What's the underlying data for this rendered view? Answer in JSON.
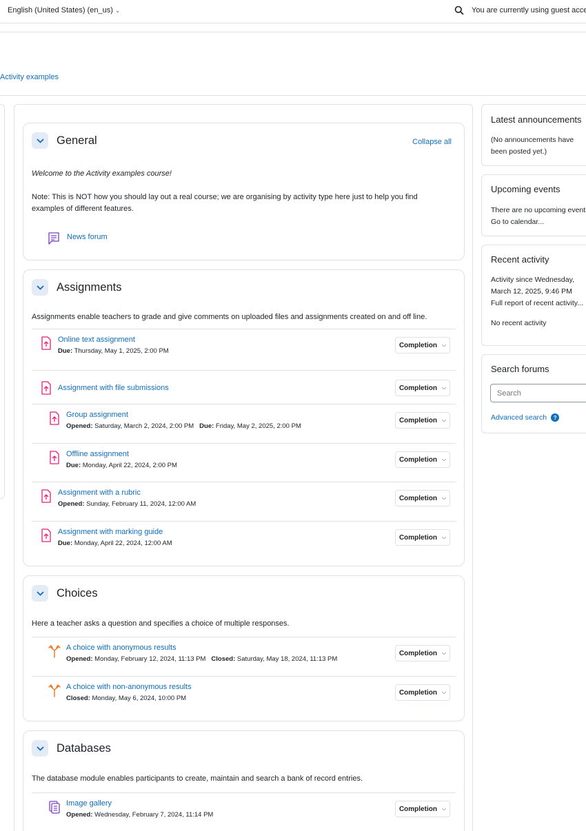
{
  "topbar": {
    "language": "English (United States) (en_us)",
    "guest_notice": "You are currently using guest access"
  },
  "breadcrumb": {
    "course": "Activity examples"
  },
  "sections": {
    "general": {
      "title": "General",
      "collapse_all": "Collapse all",
      "welcome": "Welcome to the Activity examples course!",
      "note": "Note: This is NOT how you should lay out a real course; we are organising by activity type here just to help you find examples of different features.",
      "activities": [
        {
          "name": "News forum",
          "icon": "forum-icon"
        }
      ]
    },
    "assignments": {
      "title": "Assignments",
      "summary": "Assignments enable teachers to grade and give comments on uploaded files and assignments created on and off line.",
      "activities": [
        {
          "name": "Online text assignment",
          "icon": "assignment-icon",
          "dates": [
            {
              "label": "Due:",
              "value": "Thursday, May 1, 2025, 2:00 PM"
            }
          ]
        },
        {
          "name": "Assignment with file submissions",
          "icon": "assignment-icon",
          "dates": []
        },
        {
          "name": "Group assignment",
          "icon": "assignment-icon",
          "dates": [
            {
              "label": "Opened:",
              "value": "Saturday, March 2, 2024, 2:00 PM"
            },
            {
              "label": "Due:",
              "value": "Friday, May 2, 2025, 2:00 PM"
            }
          ]
        },
        {
          "name": "Offline assignment",
          "icon": "assignment-icon",
          "dates": [
            {
              "label": "Due:",
              "value": "Monday, April 22, 2024, 2:00 PM"
            }
          ]
        },
        {
          "name": "Assignment with a rubric",
          "icon": "assignment-icon",
          "dates": [
            {
              "label": "Opened:",
              "value": "Sunday, February 11, 2024, 12:00 AM"
            }
          ]
        },
        {
          "name": "Assignment with marking guide",
          "icon": "assignment-icon",
          "dates": [
            {
              "label": "Due:",
              "value": "Monday, April 22, 2024, 12:00 AM"
            }
          ]
        }
      ]
    },
    "choices": {
      "title": "Choices",
      "summary": "Here a teacher asks a question and specifies a choice of multiple responses.",
      "activities": [
        {
          "name": "A choice with anonymous results",
          "icon": "choice-icon",
          "dates": [
            {
              "label": "Opened:",
              "value": "Monday, February 12, 2024, 11:13 PM"
            },
            {
              "label": "Closed:",
              "value": "Saturday, May 18, 2024, 11:13 PM"
            }
          ]
        },
        {
          "name": "A choice with non-anonymous results",
          "icon": "choice-icon",
          "dates": [
            {
              "label": "Closed:",
              "value": "Monday, May 6, 2024, 10:00 PM"
            }
          ]
        }
      ]
    },
    "databases": {
      "title": "Databases",
      "summary": "The database module enables participants to create, maintain and search a bank of record entries.",
      "activities": [
        {
          "name": "Image gallery",
          "icon": "database-icon",
          "dates": [
            {
              "label": "Opened:",
              "value": "Wednesday, February 7, 2024, 11:14 PM"
            }
          ]
        }
      ]
    }
  },
  "completion_label": "Completion",
  "blocks": {
    "announcements": {
      "title": "Latest announcements",
      "text": "(No announcements have been posted yet.)"
    },
    "events": {
      "title": "Upcoming events",
      "text": "There are no upcoming events",
      "link": "Go to calendar..."
    },
    "recent": {
      "title": "Recent activity",
      "since": "Activity since Wednesday, March 12, 2025, 9:46 PM",
      "link": "Full report of recent activity...",
      "none": "No recent activity"
    },
    "search": {
      "title": "Search forums",
      "placeholder": "Search",
      "advanced": "Advanced search"
    }
  },
  "colors": {
    "link": "#0f6cbf",
    "assignment": "#e91e78",
    "choice": "#e8731e",
    "forum": "#7b3fc4",
    "database": "#7b3fc4"
  }
}
